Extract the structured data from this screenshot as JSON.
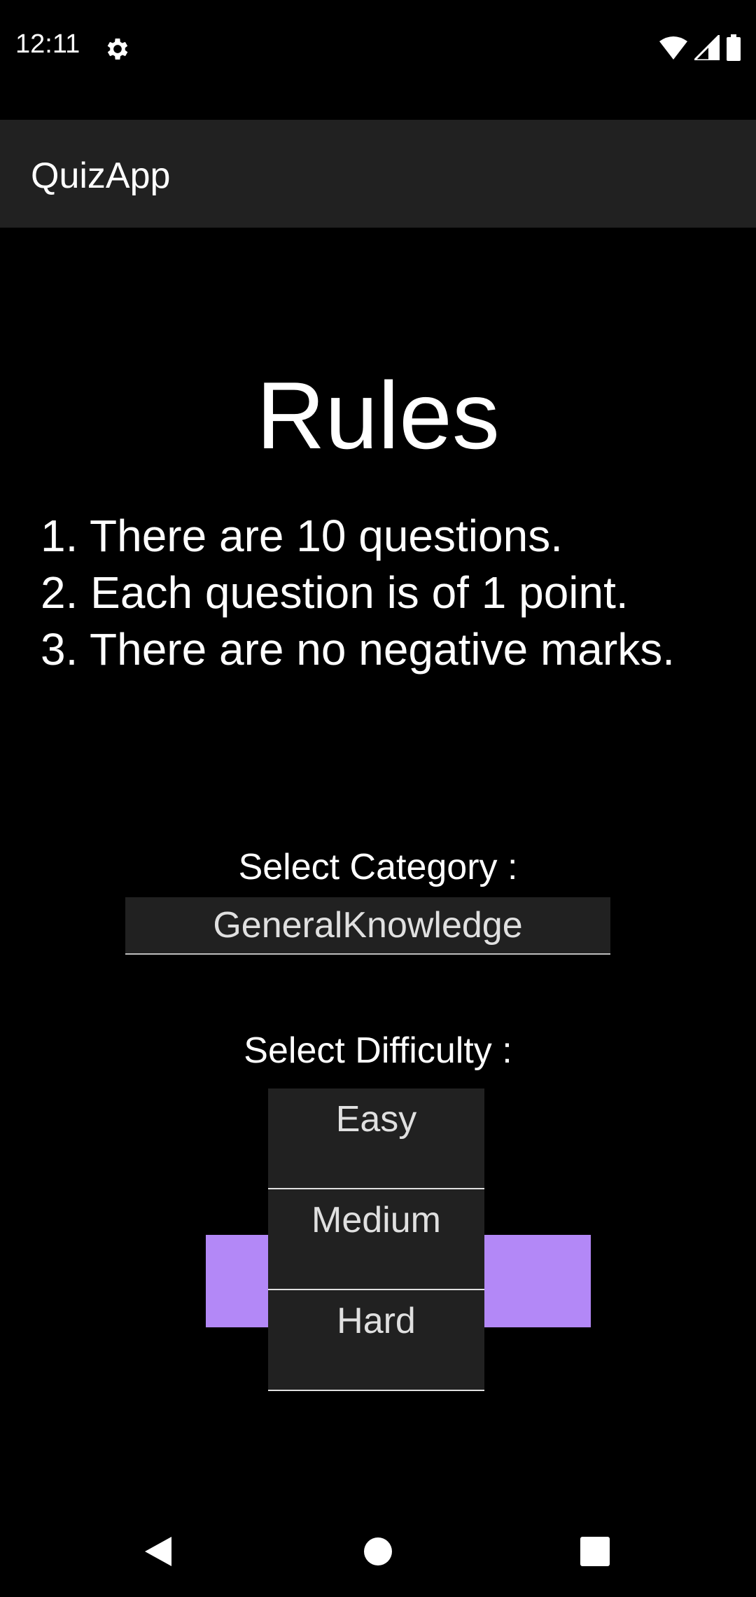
{
  "status_bar": {
    "time": "12:11",
    "icons": [
      "settings-icon",
      "wifi-icon",
      "cellular-signal-icon",
      "battery-icon"
    ]
  },
  "app_bar": {
    "title": "QuizApp"
  },
  "rules": {
    "title": "Rules",
    "items": [
      "1. There are 10 questions.",
      "2. Each question is of 1 point.",
      "3. There are no negative marks."
    ]
  },
  "category": {
    "label": "Select Category :",
    "value": "GeneralKnowledge"
  },
  "difficulty": {
    "label": "Select Difficulty :",
    "options": [
      "Easy",
      "Medium",
      "Hard"
    ]
  },
  "colors": {
    "accent": "#b388f7",
    "app_bar_bg": "#212121",
    "background": "#000000"
  },
  "nav_bar": {
    "icons": [
      "back-icon",
      "home-icon",
      "recents-icon"
    ]
  }
}
